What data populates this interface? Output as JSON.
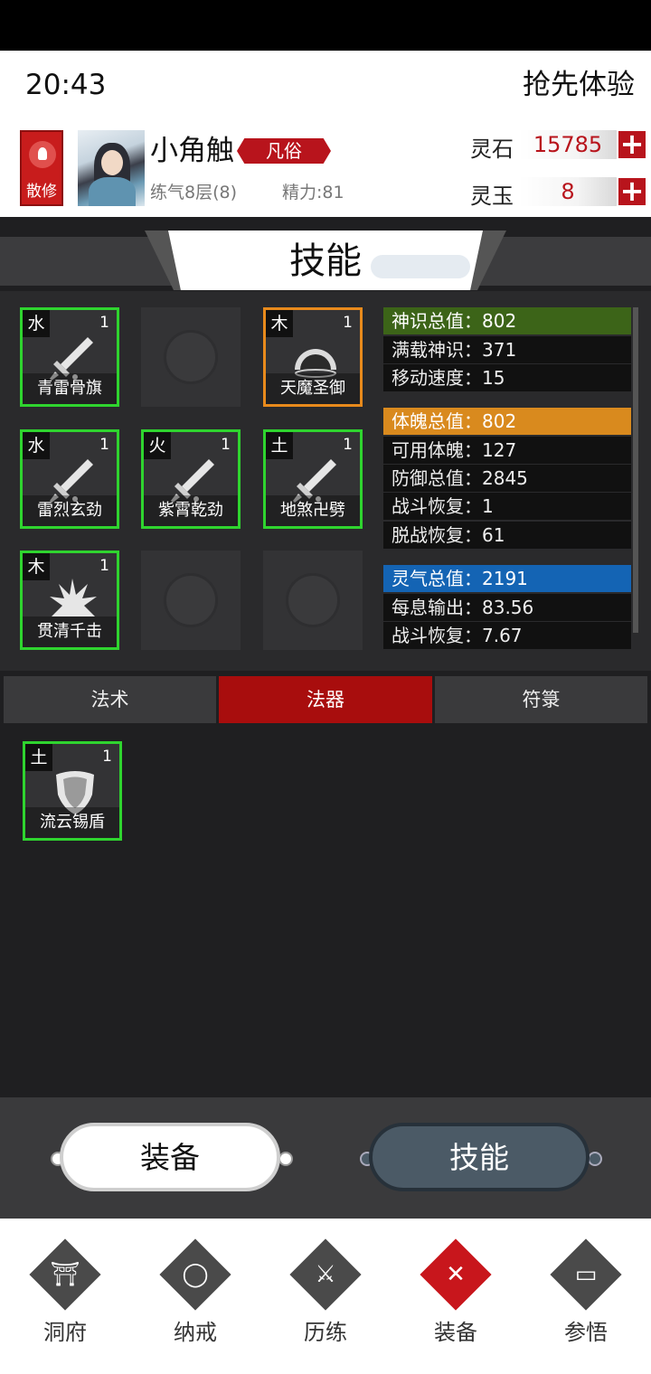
{
  "status": {
    "time": "20:43",
    "top_link": "抢先体验"
  },
  "player": {
    "sect": "散修",
    "name": "小角触",
    "rank": "凡俗",
    "level": "练气8层(8)",
    "energy": "精力:81"
  },
  "currency": [
    {
      "label": "灵石",
      "value": "15785",
      "icon": "plus-icon"
    },
    {
      "label": "灵玉",
      "value": "8",
      "icon": "plus-icon"
    }
  ],
  "page_title": "技能",
  "skills": [
    {
      "element": "水",
      "level": "1",
      "name": "青雷骨旗",
      "border": "green",
      "icon": "sword-icon"
    },
    {
      "element": "",
      "level": "",
      "name": "",
      "border": "none",
      "icon": "empty-seal-icon"
    },
    {
      "element": "木",
      "level": "1",
      "name": "天魔圣御",
      "border": "orange",
      "icon": "dome-icon"
    },
    {
      "element": "水",
      "level": "1",
      "name": "雷烈玄劲",
      "border": "green",
      "icon": "sword-icon"
    },
    {
      "element": "火",
      "level": "1",
      "name": "紫霄乾劲",
      "border": "green",
      "icon": "sword-icon"
    },
    {
      "element": "土",
      "level": "1",
      "name": "地煞卍劈",
      "border": "green",
      "icon": "sword-icon"
    },
    {
      "element": "木",
      "level": "1",
      "name": "贯清千击",
      "border": "green",
      "icon": "burst-icon"
    },
    {
      "element": "",
      "level": "",
      "name": "",
      "border": "none",
      "icon": "empty-seal-icon"
    },
    {
      "element": "",
      "level": "",
      "name": "",
      "border": "none",
      "icon": "empty-seal-icon"
    }
  ],
  "stats": {
    "group1": {
      "head": "神识总值：802",
      "head_color": "#3c6418",
      "rows": [
        "满载神识：371",
        "移动速度：15"
      ]
    },
    "group2": {
      "head": "体魄总值：802",
      "head_color": "#d98a1e",
      "rows": [
        "可用体魄：127",
        "防御总值：2845",
        "战斗恢复：1",
        "脱战恢复：61"
      ]
    },
    "group3": {
      "head": "灵气总值：2191",
      "head_color": "#1464b4",
      "rows": [
        "每息输出：83.56",
        "战斗恢复：7.67"
      ]
    }
  },
  "tabs": [
    "法术",
    "法器",
    "符箓"
  ],
  "active_tab": "法器",
  "artifacts": [
    {
      "element": "土",
      "level": "1",
      "name": "流云锡盾",
      "icon": "shield-icon"
    }
  ],
  "buttons": {
    "equip": "装备",
    "skill": "技能"
  },
  "nav": [
    {
      "label": "洞府",
      "icon": "gate-icon",
      "active": false
    },
    {
      "label": "纳戒",
      "icon": "ring-icon",
      "active": false
    },
    {
      "label": "历练",
      "icon": "crossed-swords-icon",
      "active": false
    },
    {
      "label": "装备",
      "icon": "close-icon",
      "active": true
    },
    {
      "label": "参悟",
      "icon": "book-icon",
      "active": false
    }
  ],
  "colors": {
    "accent_red": "#b8141c",
    "slot_green": "#2fd42f",
    "slot_orange": "#e88a1c"
  }
}
